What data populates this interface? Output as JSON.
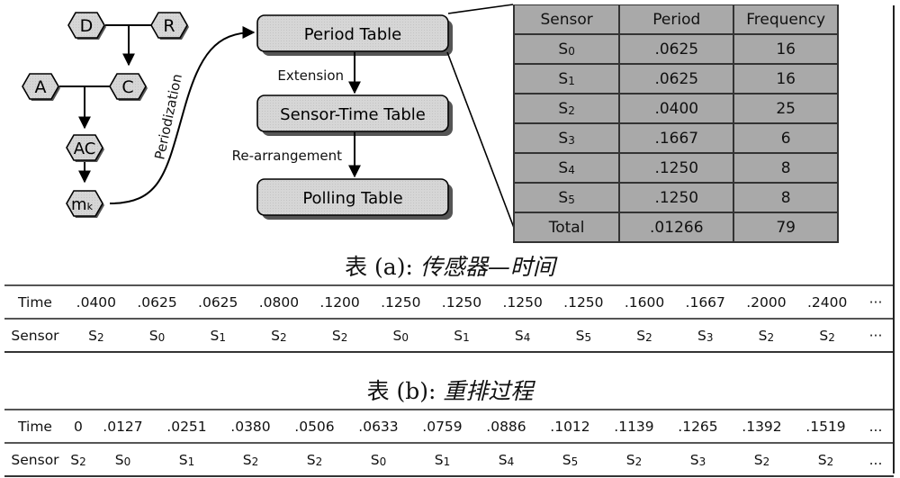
{
  "flow": {
    "nodes": {
      "d": "D",
      "r": "R",
      "a": "A",
      "c": "C",
      "ac": "AC",
      "mk_main": "m",
      "mk_sub": "k"
    },
    "periodization_label": "Periodization",
    "boxes": {
      "period_table": "Period Table",
      "sensor_time_table": "Sensor-Time Table",
      "polling_table": "Polling Table"
    },
    "edges": {
      "extension": "Extension",
      "rearrangement": "Re-arrangement"
    }
  },
  "period_table": {
    "headers": [
      "Sensor",
      "Period",
      "Frequency"
    ],
    "rows": [
      {
        "sensor": "S",
        "sub": "0",
        "period": ".0625",
        "frequency": "16"
      },
      {
        "sensor": "S",
        "sub": "1",
        "period": ".0625",
        "frequency": "16"
      },
      {
        "sensor": "S",
        "sub": "2",
        "period": ".0400",
        "frequency": "25"
      },
      {
        "sensor": "S",
        "sub": "3",
        "period": ".1667",
        "frequency": "6"
      },
      {
        "sensor": "S",
        "sub": "4",
        "period": ".1250",
        "frequency": "8"
      },
      {
        "sensor": "S",
        "sub": "5",
        "period": ".1250",
        "frequency": "8"
      }
    ],
    "total": {
      "label": "Total",
      "period": ".01266",
      "frequency": "79"
    }
  },
  "table_a": {
    "caption_label": "表 (a):",
    "caption_text": "传感器—时间",
    "time_header": "Time",
    "sensor_header": "Sensor",
    "times": [
      ".0400",
      ".0625",
      ".0625",
      ".0800",
      ".1200",
      ".1250",
      ".1250",
      ".1250",
      ".1250",
      ".1600",
      ".1667",
      ".2000",
      ".2400"
    ],
    "sensors": [
      "2",
      "0",
      "1",
      "2",
      "2",
      "0",
      "1",
      "4",
      "5",
      "2",
      "3",
      "2",
      "2"
    ],
    "sensor_prefix": "S",
    "ellipsis": "···"
  },
  "table_b": {
    "caption_label": "表 (b):",
    "caption_text": "重排过程",
    "time_header": "Time",
    "sensor_header": "Sensor",
    "times": [
      "0",
      ".0127",
      ".0251",
      ".0380",
      ".0506",
      ".0633",
      ".0759",
      ".0886",
      ".1012",
      ".1139",
      ".1265",
      ".1392",
      ".1519"
    ],
    "sensors": [
      "2",
      "0",
      "1",
      "2",
      "2",
      "0",
      "1",
      "4",
      "5",
      "2",
      "3",
      "2",
      "2"
    ],
    "sensor_prefix": "S",
    "ellipsis": "..."
  }
}
